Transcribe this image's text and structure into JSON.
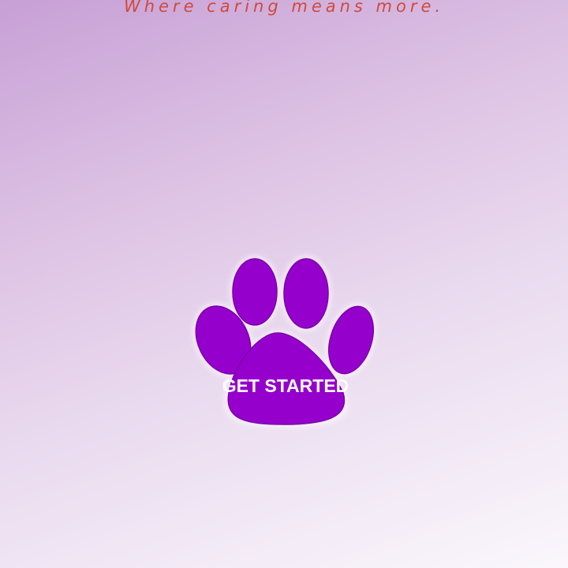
{
  "header": {
    "tagline": "Where caring means more."
  },
  "main": {
    "cta_label": "GET STARTED",
    "paw_icon": "paw-icon"
  },
  "colors": {
    "tagline": "#cf4a3c",
    "paw": "#9600cc",
    "cta_text": "#ffffff"
  }
}
